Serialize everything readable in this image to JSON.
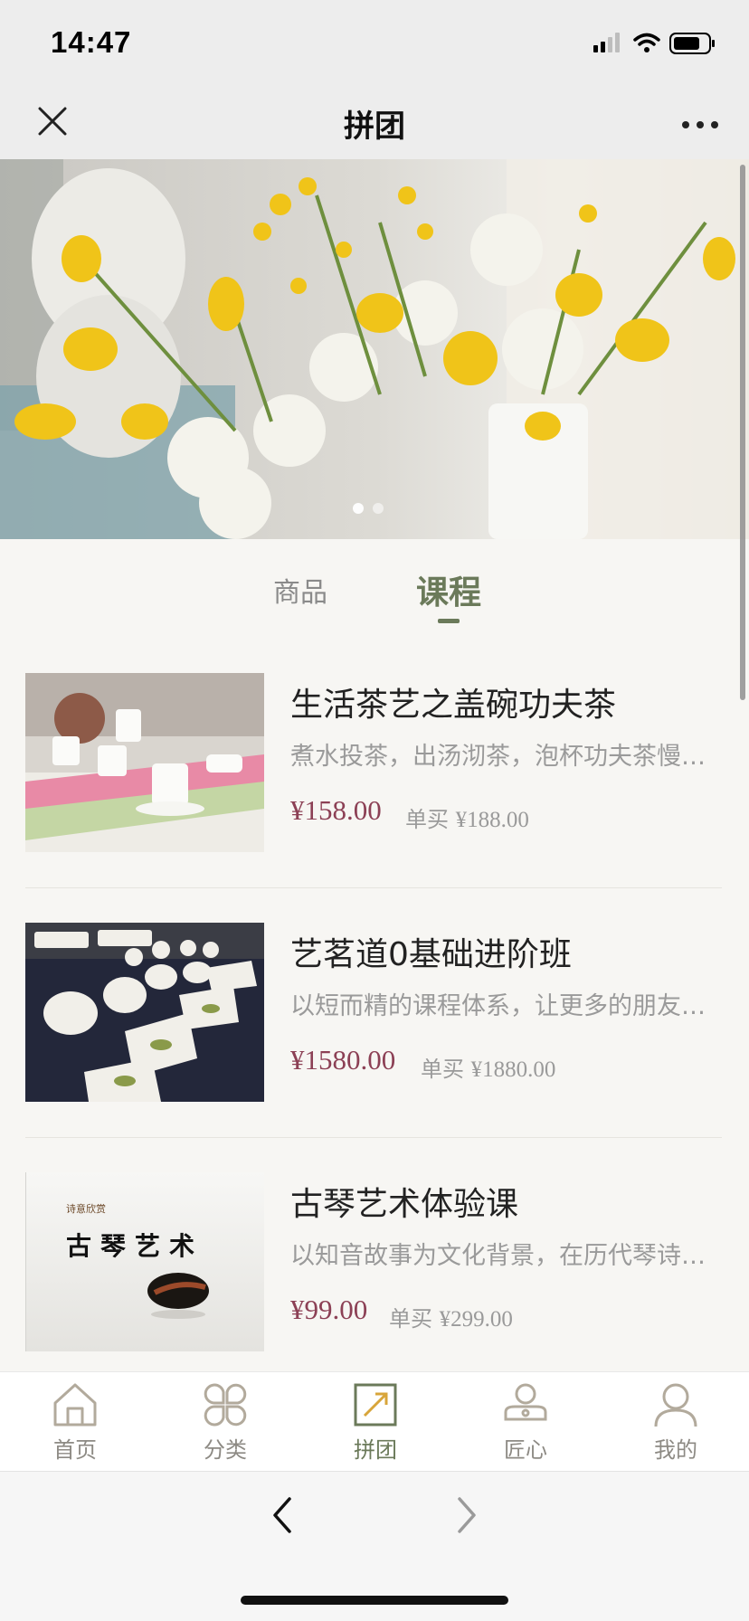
{
  "status": {
    "time": "14:47"
  },
  "nav": {
    "title": "拼团"
  },
  "tabs": {
    "goods": "商品",
    "course": "课程"
  },
  "courses": [
    {
      "title": "生活茶艺之盖碗功夫茶",
      "desc": "煮水投茶，出汤沏茶，泡杯功夫茶慢…",
      "price": "¥158.00",
      "single_label": "单买",
      "single_price": "¥188.00"
    },
    {
      "title": "艺茗道0基础进阶班",
      "desc": "以短而精的课程体系，让更多的朋友…",
      "price": "¥1580.00",
      "single_label": "单买",
      "single_price": "¥1880.00"
    },
    {
      "title": "古琴艺术体验课",
      "desc": "以知音故事为文化背景，在历代琴诗…",
      "price": "¥99.00",
      "single_label": "单买",
      "single_price": "¥299.00",
      "thumb_small": "诗意欣赏",
      "thumb_big": "古琴艺术"
    }
  ],
  "tabbar": [
    "首页",
    "分类",
    "拼团",
    "匠心",
    "我的"
  ],
  "colors": {
    "accent": "#6b7a5a",
    "price": "#8c4055"
  }
}
